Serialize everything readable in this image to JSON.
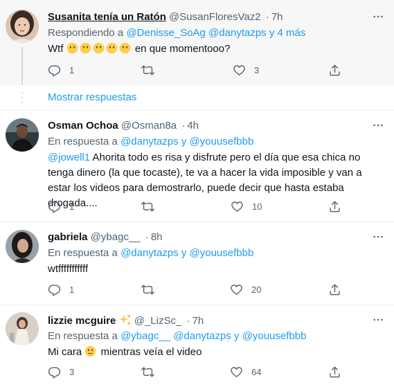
{
  "tweets": [
    {
      "name": "Susanita tenía un Ratón",
      "handle": "@SusanFloresVaz2",
      "dot": "·",
      "time": "7h",
      "reply_prefix": "Respondiendo a",
      "reply_mentions": "@Denisse_SoAg @danytazps y 4 más",
      "text_prefix": "Wtf",
      "text_suffix": "en que momentooo?",
      "replies": "1",
      "retweets": "",
      "likes": "3"
    },
    {
      "name": "Osman Ochoa",
      "handle": "@Osman8a",
      "dot": "·",
      "time": "4h",
      "reply_prefix": "En respuesta a",
      "reply_mentions": "@danytazps y @youusefbbb",
      "text_mention": "@jowell1",
      "text": " Ahorita todo es risa y disfrute pero el día que esa chica no tenga dinero (la que tocaste), te va a hacer la vida imposible y van a estar los videos para demostrarlo, puede decir que hasta estaba drogada....",
      "replies": "1",
      "retweets": "",
      "likes": "10"
    },
    {
      "name": "gabriela",
      "handle": "@ybagc__",
      "dot": "·",
      "time": "8h",
      "reply_prefix": "En respuesta a",
      "reply_mentions": "@danytazps y @youusefbbb",
      "text": "wtfffffffffff",
      "replies": "1",
      "retweets": "",
      "likes": "20"
    },
    {
      "name": "lizzie mcguire",
      "handle": "@_LizSc_",
      "dot": "·",
      "time": "7h",
      "reply_prefix": "En respuesta a",
      "reply_mentions": "@ybagc__ @danytazps y @youusefbbb",
      "text_prefix": "Mi cara",
      "text_suffix": "mientras veía el video",
      "replies": "3",
      "retweets": "",
      "likes": "64"
    }
  ],
  "show_replies_label": "Mostrar respuestas",
  "colors": {
    "accent": "#1d9bf0",
    "secondary_text": "#536471",
    "highlight_bg": "#f7f7f7"
  },
  "icons": [
    "reply-icon",
    "retweet-icon",
    "like-icon",
    "share-icon",
    "more-icon",
    "sparkles-icon",
    "emoji-no-mouth-icon",
    "emoji-neutral-icon"
  ]
}
